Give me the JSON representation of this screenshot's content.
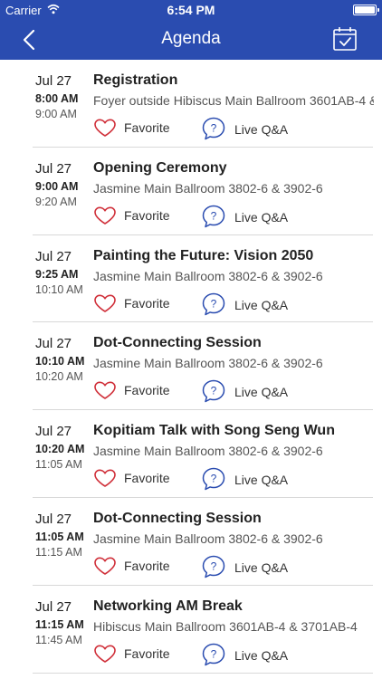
{
  "status_bar": {
    "carrier": "Carrier",
    "time": "6:54 PM"
  },
  "nav": {
    "title": "Agenda"
  },
  "labels": {
    "favorite": "Favorite",
    "live_qa": "Live Q&A"
  },
  "colors": {
    "brand": "#2a4cb0",
    "heart": "#d0303a",
    "qa": "#2a4cb0"
  },
  "sessions": [
    {
      "date": "Jul 27",
      "start": "8:00 AM",
      "end": "9:00 AM",
      "title": "Registration",
      "location": "Foyer outside Hibiscus Main Ballroom 3601AB-4 &"
    },
    {
      "date": "Jul 27",
      "start": "9:00 AM",
      "end": "9:20 AM",
      "title": "Opening Ceremony",
      "location": "Jasmine Main Ballroom 3802-6 & 3902-6"
    },
    {
      "date": "Jul 27",
      "start": "9:25 AM",
      "end": "10:10 AM",
      "title": "Painting the Future: Vision 2050",
      "location": "Jasmine Main Ballroom 3802-6 & 3902-6"
    },
    {
      "date": "Jul 27",
      "start": "10:10 AM",
      "end": "10:20 AM",
      "title": "Dot-Connecting Session",
      "location": "Jasmine Main Ballroom 3802-6 & 3902-6"
    },
    {
      "date": "Jul 27",
      "start": "10:20 AM",
      "end": "11:05 AM",
      "title": "Kopitiam Talk with Song Seng Wun",
      "location": "Jasmine Main Ballroom 3802-6 & 3902-6"
    },
    {
      "date": "Jul 27",
      "start": "11:05 AM",
      "end": "11:15 AM",
      "title": "Dot-Connecting Session",
      "location": "Jasmine Main Ballroom 3802-6 & 3902-6"
    },
    {
      "date": "Jul 27",
      "start": "11:15 AM",
      "end": "11:45 AM",
      "title": "Networking AM Break",
      "location": "Hibiscus Main Ballroom 3601AB-4 & 3701AB-4"
    }
  ]
}
